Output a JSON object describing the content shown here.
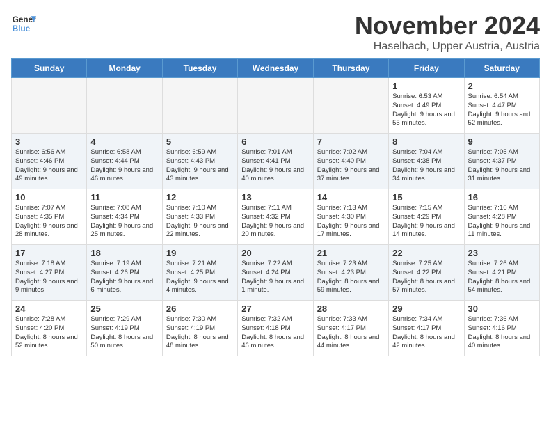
{
  "logo": {
    "line1": "General",
    "line2": "Blue"
  },
  "title": "November 2024",
  "location": "Haselbach, Upper Austria, Austria",
  "weekdays": [
    "Sunday",
    "Monday",
    "Tuesday",
    "Wednesday",
    "Thursday",
    "Friday",
    "Saturday"
  ],
  "weeks": [
    [
      {
        "day": "",
        "content": ""
      },
      {
        "day": "",
        "content": ""
      },
      {
        "day": "",
        "content": ""
      },
      {
        "day": "",
        "content": ""
      },
      {
        "day": "",
        "content": ""
      },
      {
        "day": "1",
        "content": "Sunrise: 6:53 AM\nSunset: 4:49 PM\nDaylight: 9 hours and 55 minutes."
      },
      {
        "day": "2",
        "content": "Sunrise: 6:54 AM\nSunset: 4:47 PM\nDaylight: 9 hours and 52 minutes."
      }
    ],
    [
      {
        "day": "3",
        "content": "Sunrise: 6:56 AM\nSunset: 4:46 PM\nDaylight: 9 hours and 49 minutes."
      },
      {
        "day": "4",
        "content": "Sunrise: 6:58 AM\nSunset: 4:44 PM\nDaylight: 9 hours and 46 minutes."
      },
      {
        "day": "5",
        "content": "Sunrise: 6:59 AM\nSunset: 4:43 PM\nDaylight: 9 hours and 43 minutes."
      },
      {
        "day": "6",
        "content": "Sunrise: 7:01 AM\nSunset: 4:41 PM\nDaylight: 9 hours and 40 minutes."
      },
      {
        "day": "7",
        "content": "Sunrise: 7:02 AM\nSunset: 4:40 PM\nDaylight: 9 hours and 37 minutes."
      },
      {
        "day": "8",
        "content": "Sunrise: 7:04 AM\nSunset: 4:38 PM\nDaylight: 9 hours and 34 minutes."
      },
      {
        "day": "9",
        "content": "Sunrise: 7:05 AM\nSunset: 4:37 PM\nDaylight: 9 hours and 31 minutes."
      }
    ],
    [
      {
        "day": "10",
        "content": "Sunrise: 7:07 AM\nSunset: 4:35 PM\nDaylight: 9 hours and 28 minutes."
      },
      {
        "day": "11",
        "content": "Sunrise: 7:08 AM\nSunset: 4:34 PM\nDaylight: 9 hours and 25 minutes."
      },
      {
        "day": "12",
        "content": "Sunrise: 7:10 AM\nSunset: 4:33 PM\nDaylight: 9 hours and 22 minutes."
      },
      {
        "day": "13",
        "content": "Sunrise: 7:11 AM\nSunset: 4:32 PM\nDaylight: 9 hours and 20 minutes."
      },
      {
        "day": "14",
        "content": "Sunrise: 7:13 AM\nSunset: 4:30 PM\nDaylight: 9 hours and 17 minutes."
      },
      {
        "day": "15",
        "content": "Sunrise: 7:15 AM\nSunset: 4:29 PM\nDaylight: 9 hours and 14 minutes."
      },
      {
        "day": "16",
        "content": "Sunrise: 7:16 AM\nSunset: 4:28 PM\nDaylight: 9 hours and 11 minutes."
      }
    ],
    [
      {
        "day": "17",
        "content": "Sunrise: 7:18 AM\nSunset: 4:27 PM\nDaylight: 9 hours and 9 minutes."
      },
      {
        "day": "18",
        "content": "Sunrise: 7:19 AM\nSunset: 4:26 PM\nDaylight: 9 hours and 6 minutes."
      },
      {
        "day": "19",
        "content": "Sunrise: 7:21 AM\nSunset: 4:25 PM\nDaylight: 9 hours and 4 minutes."
      },
      {
        "day": "20",
        "content": "Sunrise: 7:22 AM\nSunset: 4:24 PM\nDaylight: 9 hours and 1 minute."
      },
      {
        "day": "21",
        "content": "Sunrise: 7:23 AM\nSunset: 4:23 PM\nDaylight: 8 hours and 59 minutes."
      },
      {
        "day": "22",
        "content": "Sunrise: 7:25 AM\nSunset: 4:22 PM\nDaylight: 8 hours and 57 minutes."
      },
      {
        "day": "23",
        "content": "Sunrise: 7:26 AM\nSunset: 4:21 PM\nDaylight: 8 hours and 54 minutes."
      }
    ],
    [
      {
        "day": "24",
        "content": "Sunrise: 7:28 AM\nSunset: 4:20 PM\nDaylight: 8 hours and 52 minutes."
      },
      {
        "day": "25",
        "content": "Sunrise: 7:29 AM\nSunset: 4:19 PM\nDaylight: 8 hours and 50 minutes."
      },
      {
        "day": "26",
        "content": "Sunrise: 7:30 AM\nSunset: 4:19 PM\nDaylight: 8 hours and 48 minutes."
      },
      {
        "day": "27",
        "content": "Sunrise: 7:32 AM\nSunset: 4:18 PM\nDaylight: 8 hours and 46 minutes."
      },
      {
        "day": "28",
        "content": "Sunrise: 7:33 AM\nSunset: 4:17 PM\nDaylight: 8 hours and 44 minutes."
      },
      {
        "day": "29",
        "content": "Sunrise: 7:34 AM\nSunset: 4:17 PM\nDaylight: 8 hours and 42 minutes."
      },
      {
        "day": "30",
        "content": "Sunrise: 7:36 AM\nSunset: 4:16 PM\nDaylight: 8 hours and 40 minutes."
      }
    ]
  ]
}
